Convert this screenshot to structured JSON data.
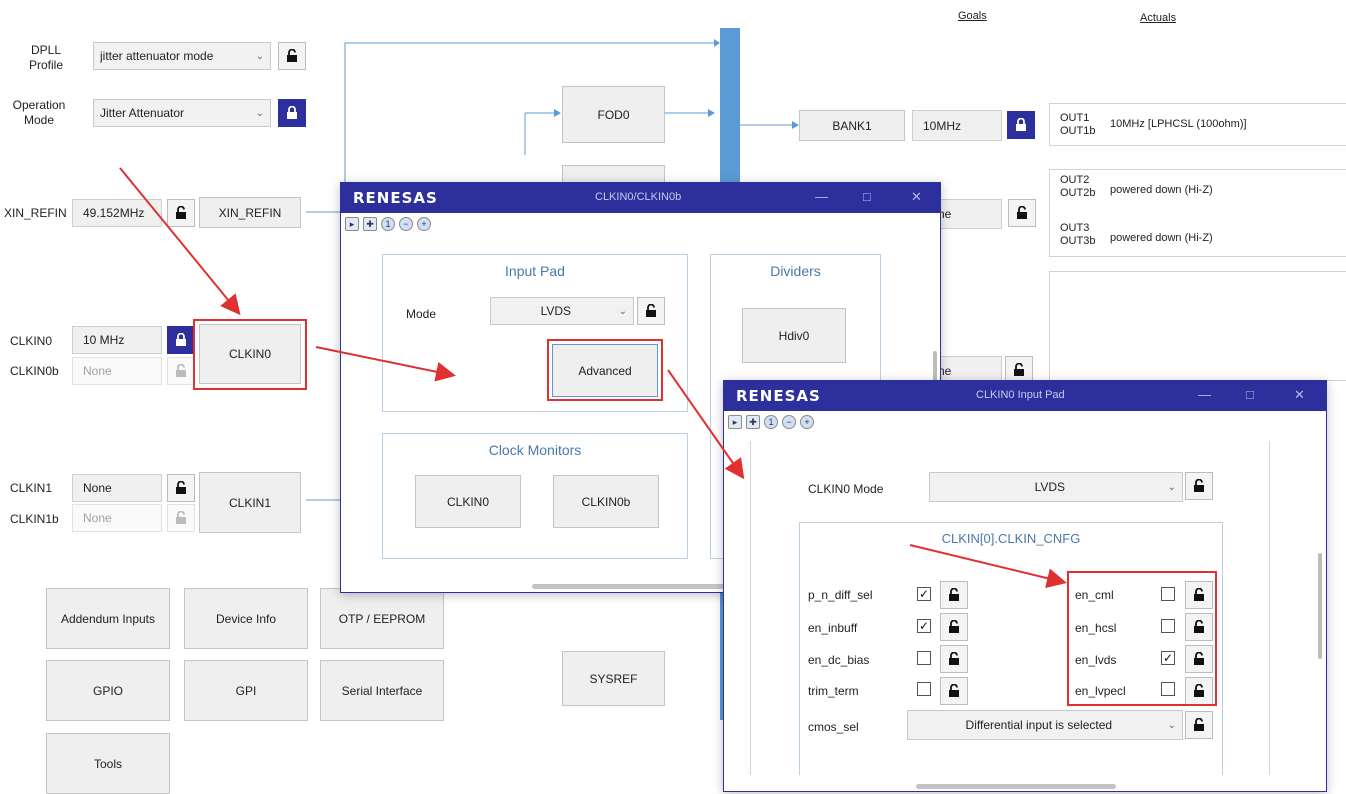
{
  "header": {
    "goals": "Goals",
    "actuals": "Actuals"
  },
  "settings": {
    "dpll_profile_label": "DPLL\nProfile",
    "dpll_profile_value": "jitter attenuator mode",
    "operation_mode_label": "Operation\nMode",
    "operation_mode_value": "Jitter Attenuator"
  },
  "inputs": {
    "xin_label": "XIN_REFIN",
    "xin_freq": "49.152MHz",
    "xin_box": "XIN_REFIN",
    "clkin0_label": "CLKIN0",
    "clkin0_freq": "10 MHz",
    "clkin0b_label": "CLKIN0b",
    "clkin0b_freq": "None",
    "clkin0_box": "CLKIN0",
    "clkin1_label": "CLKIN1",
    "clkin1_freq": "None",
    "clkin1b_label": "CLKIN1b",
    "clkin1b_freq": "None",
    "clkin1_box": "CLKIN1"
  },
  "core": {
    "fod0": "FOD0",
    "sysref": "SYSREF",
    "bank1": "BANK1",
    "bank1_freq": "10MHz",
    "hidden1": "ne",
    "hidden2": "ne"
  },
  "outputs": [
    {
      "names": "OUT1\nOUT1b",
      "value": "10MHz [LPHCSL (100ohm)]"
    },
    {
      "names": "OUT2\nOUT2b",
      "value": "powered down (Hi-Z)"
    },
    {
      "names": "OUT3\nOUT3b",
      "value": "powered down (Hi-Z)"
    }
  ],
  "nav_buttons": [
    "Addendum Inputs",
    "Device Info",
    "OTP / EEPROM",
    "GPIO",
    "GPI",
    "Serial Interface",
    "Tools"
  ],
  "dialog1": {
    "logo": "RENESAS",
    "title": "CLKIN0/CLKIN0b",
    "input_pad_title": "Input Pad",
    "mode_label": "Mode",
    "mode_value": "LVDS",
    "advanced_label": "Advanced",
    "dividers_title": "Dividers",
    "hdiv0": "Hdiv0",
    "clock_monitors_title": "Clock Monitors",
    "mon_clkin0": "CLKIN0",
    "mon_clkin0b": "CLKIN0b"
  },
  "dialog2": {
    "logo": "RENESAS",
    "title": "CLKIN0 Input Pad",
    "mode_label": "CLKIN0 Mode",
    "mode_value": "LVDS",
    "group_title": "CLKIN[0].CLKIN_CNFG",
    "left_bits": [
      {
        "name": "p_n_diff_sel",
        "checked": true
      },
      {
        "name": "en_inbuff",
        "checked": true
      },
      {
        "name": "en_dc_bias",
        "checked": false
      },
      {
        "name": "trim_term",
        "checked": false
      }
    ],
    "right_bits": [
      {
        "name": "en_cml",
        "checked": false
      },
      {
        "name": "en_hcsl",
        "checked": false
      },
      {
        "name": "en_lvds",
        "checked": true
      },
      {
        "name": "en_lvpecl",
        "checked": false
      }
    ],
    "cmos_label": "cmos_sel",
    "cmos_value": "Differential input is selected"
  },
  "colors": {
    "accent": "#2d2f9c",
    "highlight": "#e03030",
    "wire": "#5b9bd5",
    "group_title": "#4a78a8"
  }
}
